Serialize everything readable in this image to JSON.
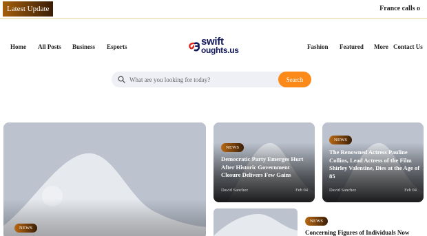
{
  "topbar": {
    "latest_label": "Latest Update",
    "ticker_text": "France calls o"
  },
  "nav": {
    "left": [
      "Home",
      "All Posts",
      "Business",
      "Esports"
    ],
    "right": [
      "Fashion",
      "Featured",
      "More",
      "Contact Us"
    ]
  },
  "logo": {
    "line1": "swift",
    "line2": "oughts.us"
  },
  "search": {
    "placeholder": "What are you looking for today?",
    "button_label": "Search"
  },
  "colors": {
    "accent": "#fb8a1b",
    "badge_dark": "#3c1f06",
    "logo_navy": "#12185a",
    "logo_red": "#e0261b",
    "placeholder_bg": "#bcc3cf"
  },
  "featured": {
    "badge": "NEWS"
  },
  "cards": [
    {
      "badge": "NEWS",
      "title": "Democratic Party Emerges Hurt After Historic Government Closure Delivers Few Gains",
      "author": "David Sanchez",
      "date": "Feb 04"
    },
    {
      "badge": "NEWS",
      "title": "The Renowned Actress Pauline Collins, Lead Actress of the Film Shirley Valentine, Dies at the Age of 85",
      "author": "David Sanchez",
      "date": "Feb 04"
    }
  ],
  "list_item": {
    "badge": "NEWS",
    "title": "Concerning Figures of Individuals Now"
  }
}
